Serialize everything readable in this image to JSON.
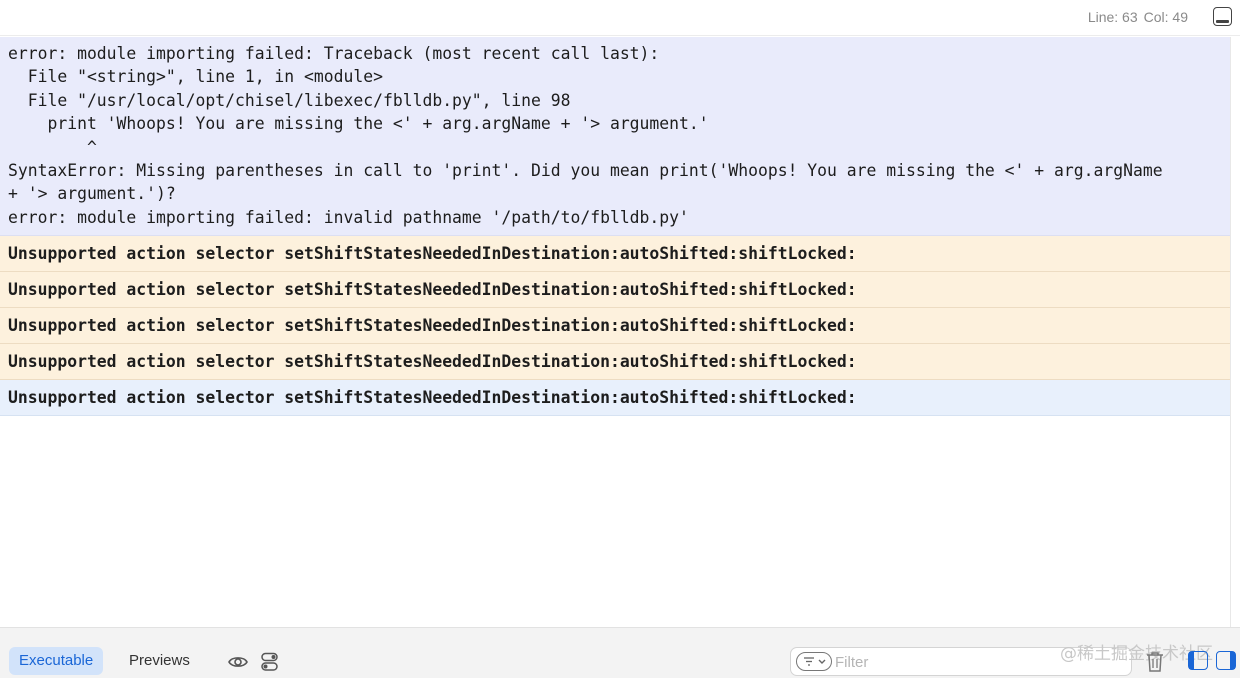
{
  "status": {
    "line_label": "Line: 63",
    "col_label": "Col: 49"
  },
  "console": {
    "error_block": [
      "error: module importing failed: Traceback (most recent call last):",
      "  File \"<string>\", line 1, in <module>",
      "  File \"/usr/local/opt/chisel/libexec/fblldb.py\", line 98",
      "    print 'Whoops! You are missing the <' + arg.argName + '> argument.'",
      "        ^",
      "SyntaxError: Missing parentheses in call to 'print'. Did you mean print('Whoops! You are missing the <' + arg.argName",
      "+ '> argument.')?",
      "error: module importing failed: invalid pathname '/path/to/fblldb.py'"
    ],
    "warnings": [
      "Unsupported action selector setShiftStatesNeededInDestination:autoShifted:shiftLocked:",
      "Unsupported action selector setShiftStatesNeededInDestination:autoShifted:shiftLocked:",
      "Unsupported action selector setShiftStatesNeededInDestination:autoShifted:shiftLocked:",
      "Unsupported action selector setShiftStatesNeededInDestination:autoShifted:shiftLocked:"
    ],
    "selected_message": "Unsupported action selector setShiftStatesNeededInDestination:autoShifted:shiftLocked:"
  },
  "toolbar": {
    "tab_executable": "Executable",
    "tab_previews": "Previews",
    "filter_placeholder": "Filter",
    "watermark": "@稀土掘金技术社区"
  },
  "colors": {
    "accent": "#1a66d6",
    "error_bg": "#e9ebfb",
    "warning_bg": "#fdf1dd",
    "selected_bg": "#e8f0fc"
  }
}
